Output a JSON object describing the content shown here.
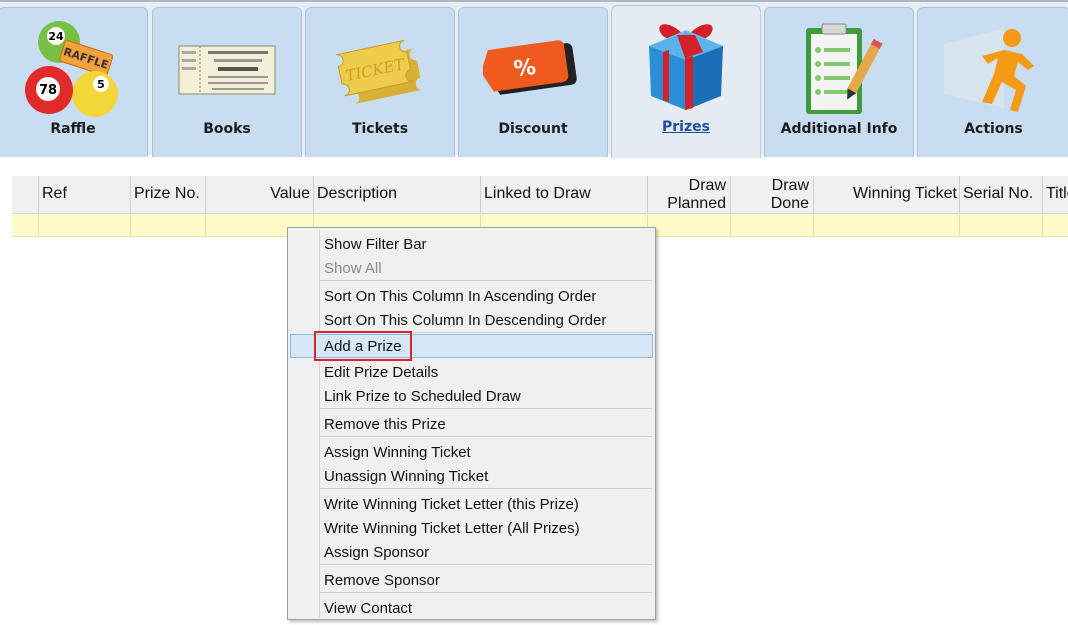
{
  "tabs": [
    {
      "label": "Raffle",
      "icon": "raffle-balls-icon"
    },
    {
      "label": "Books",
      "icon": "raffle-book-icon"
    },
    {
      "label": "Tickets",
      "icon": "ticket-icon"
    },
    {
      "label": "Discount",
      "icon": "discount-tag-icon"
    },
    {
      "label": "Prizes",
      "icon": "gift-box-icon",
      "active": true
    },
    {
      "label": "Additional Info",
      "icon": "clipboard-icon"
    },
    {
      "label": "Actions",
      "icon": "running-man-icon"
    }
  ],
  "grid": {
    "columns": {
      "ref": "Ref",
      "prize_no": "Prize No.",
      "value": "Value",
      "description": "Description",
      "linked_to_draw": "Linked to Draw",
      "draw_planned_1": "Draw",
      "draw_planned_2": "Planned",
      "draw_done_1": "Draw",
      "draw_done_2": "Done",
      "winning_ticket": "Winning Ticket",
      "serial_no": "Serial No.",
      "title": "Title"
    }
  },
  "context_menu": {
    "items": [
      {
        "label": "Show Filter Bar",
        "enabled": true
      },
      {
        "label": "Show All",
        "enabled": false
      },
      {
        "label": "Sort On This Column In Ascending Order",
        "enabled": true
      },
      {
        "label": "Sort On This Column In Descending Order",
        "enabled": true
      },
      {
        "label": "Add a Prize",
        "enabled": true,
        "highlighted": true
      },
      {
        "label": "Edit Prize Details",
        "enabled": true
      },
      {
        "label": "Link Prize to Scheduled Draw",
        "enabled": true
      },
      {
        "label": "Remove this Prize",
        "enabled": true
      },
      {
        "label": "Assign Winning Ticket",
        "enabled": true
      },
      {
        "label": "Unassign Winning Ticket",
        "enabled": true
      },
      {
        "label": "Write Winning Ticket Letter (this Prize)",
        "enabled": true
      },
      {
        "label": "Write Winning Ticket Letter (All Prizes)",
        "enabled": true
      },
      {
        "label": "Assign Sponsor",
        "enabled": true
      },
      {
        "label": "Remove Sponsor",
        "enabled": true
      },
      {
        "label": "View Contact",
        "enabled": true
      }
    ]
  },
  "colors": {
    "tab_bg": "#c8ddf1",
    "active_tab_label": "#1f4f9c",
    "row_highlight": "#fffbc7",
    "menu_highlight": "#d6e8f7",
    "annotation_box": "#d9252b"
  }
}
